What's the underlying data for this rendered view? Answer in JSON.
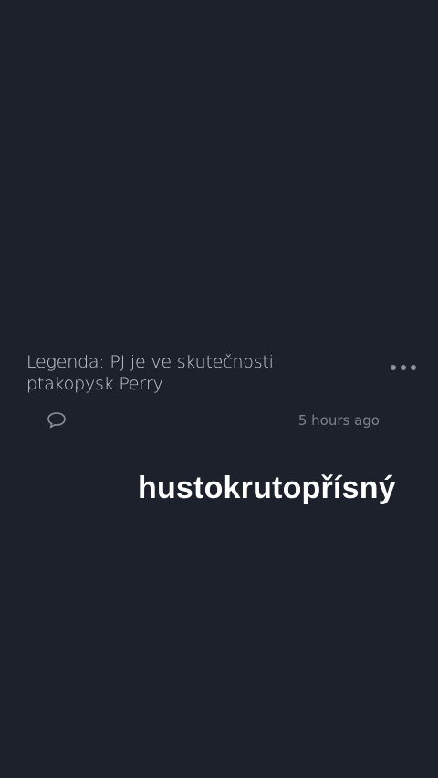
{
  "comment": {
    "text": "Legenda: PJ je ve skutečnosti ptakopysk Perry",
    "timestamp": "5 hours ago"
  },
  "icons": {
    "more": "more-horizontal-icon",
    "reply": "speech-bubble-icon"
  },
  "overlay": {
    "text": "hustokrutopřísný"
  },
  "colors": {
    "background": "#1c212c",
    "comment_text": "#c9ccd3",
    "muted": "#7d828c",
    "overlay_text": "#ffffff"
  }
}
